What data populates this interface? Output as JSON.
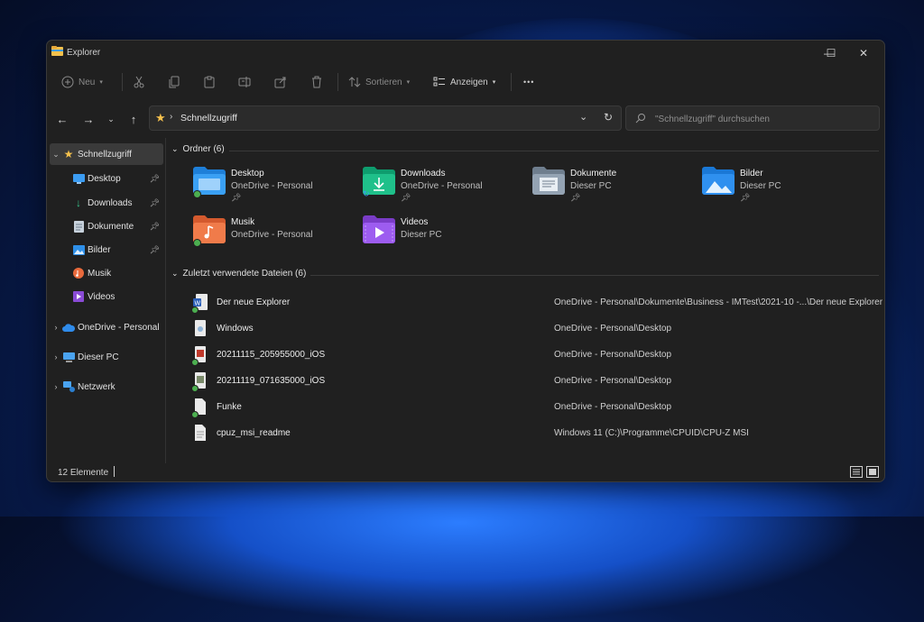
{
  "window": {
    "title": "Explorer",
    "controls": {
      "minimize": "—",
      "maximize": "☐",
      "close": "✕"
    }
  },
  "toolbar": {
    "new_label": "Neu",
    "sort_label": "Sortieren",
    "view_label": "Anzeigen",
    "more_label": "•••",
    "icons": [
      "cut-icon",
      "copy-icon",
      "paste-icon",
      "rename-icon",
      "share-icon",
      "delete-icon"
    ]
  },
  "address": {
    "path": "Schnellzugriff"
  },
  "search": {
    "placeholder": "\"Schnellzugriff\" durchsuchen"
  },
  "sidebar": {
    "quick_access": "Schnellzugriff",
    "items": [
      {
        "label": "Desktop",
        "icon": "desktop-icon"
      },
      {
        "label": "Downloads",
        "icon": "download-icon"
      },
      {
        "label": "Dokumente",
        "icon": "documents-icon"
      },
      {
        "label": "Bilder",
        "icon": "pictures-icon"
      },
      {
        "label": "Musik",
        "icon": "music-icon"
      },
      {
        "label": "Videos",
        "icon": "videos-icon"
      }
    ],
    "onedrive": "OneDrive - Personal",
    "this_pc": "Dieser PC",
    "network": "Netzwerk"
  },
  "folders_group": "Ordner (6)",
  "folders": [
    {
      "name": "Desktop",
      "location": "OneDrive - Personal"
    },
    {
      "name": "Downloads",
      "location": "OneDrive - Personal"
    },
    {
      "name": "Dokumente",
      "location": "Dieser PC"
    },
    {
      "name": "Bilder",
      "location": "Dieser PC"
    },
    {
      "name": "Musik",
      "location": "OneDrive - Personal"
    },
    {
      "name": "Videos",
      "location": "Dieser PC"
    }
  ],
  "recent_group": "Zuletzt verwendete Dateien (6)",
  "recent_files": [
    {
      "name": "Der neue Explorer",
      "path": "OneDrive - Personal\\Dokumente\\Business - IMTest\\2021-10 -...\\Der neue Explorer"
    },
    {
      "name": "Windows",
      "path": "OneDrive - Personal\\Desktop"
    },
    {
      "name": "20211115_205955000_iOS",
      "path": "OneDrive - Personal\\Desktop"
    },
    {
      "name": "20211119_071635000_iOS",
      "path": "OneDrive - Personal\\Desktop"
    },
    {
      "name": "Funke",
      "path": "OneDrive - Personal\\Desktop"
    },
    {
      "name": "cpuz_msi_readme",
      "path": "Windows 11 (C:)\\Programme\\CPUID\\CPU-Z MSI"
    }
  ],
  "status": {
    "count": "12 Elemente"
  },
  "colors": {
    "accent": "#3b9cf2",
    "folder_yellow": "#f5c14d",
    "sync_green": "#4caf50",
    "window_bg": "#202020"
  }
}
